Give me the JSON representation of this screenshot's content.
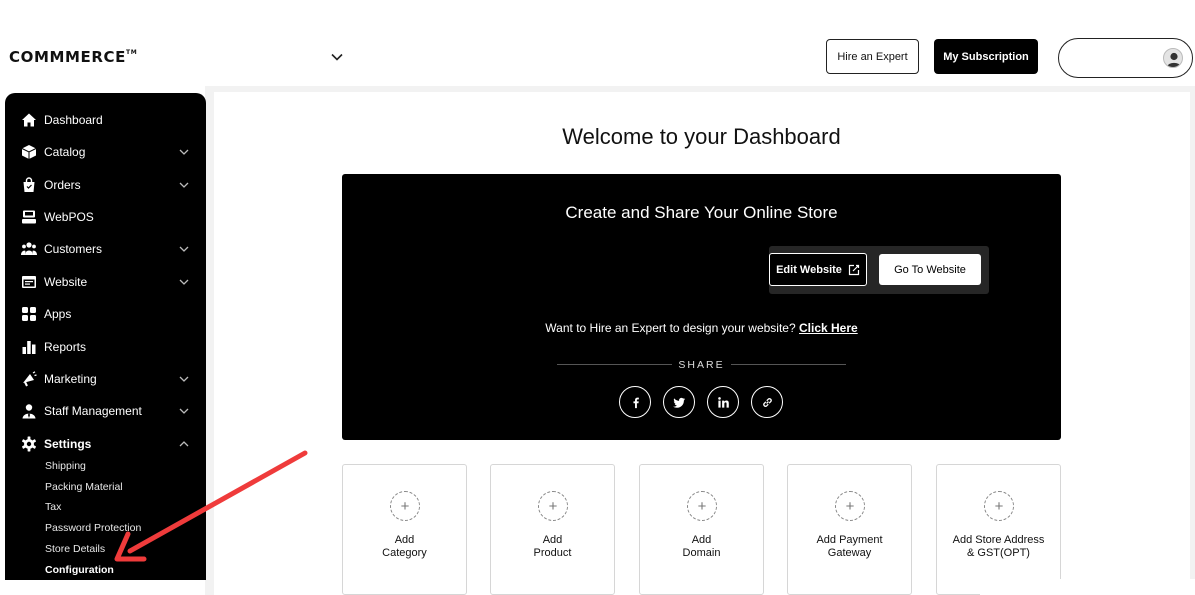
{
  "header": {
    "logo_text": "COMMMERCE",
    "logo_tm": "TM",
    "hire_expert_label": "Hire an Expert",
    "subscription_label": "My Subscription"
  },
  "sidebar": {
    "items": [
      {
        "label": "Dashboard",
        "icon": "home-icon",
        "has_chevron": false
      },
      {
        "label": "Catalog",
        "icon": "box-icon",
        "has_chevron": true
      },
      {
        "label": "Orders",
        "icon": "shopping-bag-icon",
        "has_chevron": true
      },
      {
        "label": "WebPOS",
        "icon": "pos-register-icon",
        "has_chevron": false
      },
      {
        "label": "Customers",
        "icon": "users-icon",
        "has_chevron": true
      },
      {
        "label": "Website",
        "icon": "browser-icon",
        "has_chevron": true
      },
      {
        "label": "Apps",
        "icon": "grid-icon",
        "has_chevron": false
      },
      {
        "label": "Reports",
        "icon": "bar-chart-icon",
        "has_chevron": false
      },
      {
        "label": "Marketing",
        "icon": "megaphone-icon",
        "has_chevron": true
      },
      {
        "label": "Staff Management",
        "icon": "staff-icon",
        "has_chevron": true
      },
      {
        "label": "Settings",
        "icon": "gear-icon",
        "has_chevron": true,
        "expanded": true
      }
    ],
    "settings_sub": [
      "Shipping",
      "Packing Material",
      "Tax",
      "Password Protection",
      "Store Details",
      "Configuration"
    ],
    "active_sub": "Configuration"
  },
  "main": {
    "welcome_title": "Welcome to your Dashboard",
    "hero": {
      "title": "Create and Share Your Online Store",
      "edit_label": "Edit Website",
      "go_label": "Go To Website",
      "hire_text": "Want to Hire an Expert to design your website?",
      "click_here": "Click Here",
      "share_label": "SHARE",
      "social_icons": [
        "facebook-icon",
        "twitter-icon",
        "linkedin-icon",
        "link-icon"
      ]
    },
    "cards": [
      {
        "line1": "Add",
        "line2": "Category"
      },
      {
        "line1": "Add",
        "line2": "Product"
      },
      {
        "line1": "Add",
        "line2": "Domain"
      },
      {
        "line1": "Add Payment",
        "line2": "Gateway"
      },
      {
        "line1": "Add Store Address",
        "line2": "& GST(OPT)"
      }
    ]
  },
  "colors": {
    "sidebar_bg": "#000000",
    "hero_bg": "#000000",
    "annotation_arrow": "#ef3b3b"
  }
}
